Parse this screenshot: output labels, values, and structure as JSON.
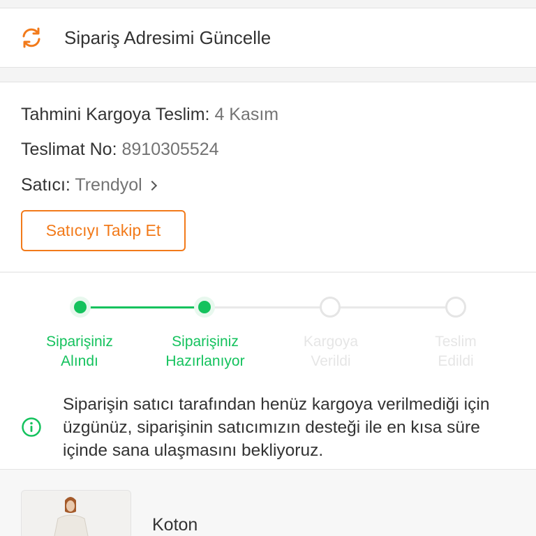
{
  "update_address": {
    "label": "Sipariş Adresimi Güncelle",
    "icon": "refresh-icon",
    "icon_color": "#f27a1a"
  },
  "delivery": {
    "estimate_key": "Tahmini Kargoya Teslim:",
    "estimate_value": "4 Kasım",
    "number_key": "Teslimat No:",
    "number_value": "8910305524",
    "seller_key": "Satıcı:",
    "seller_value": "Trendyol"
  },
  "follow_button": {
    "label": "Satıcıyı Takip Et",
    "color": "#f27a1a"
  },
  "tracker": {
    "active_color": "#14c25d",
    "steps": [
      {
        "label": "Siparişiniz\nAlındı",
        "status": "done"
      },
      {
        "label": "Siparişiniz\nHazırlanıyor",
        "status": "done"
      },
      {
        "label": "Kargoya\nVerildi",
        "status": "pending"
      },
      {
        "label": "Teslim\nEdildi",
        "status": "pending"
      }
    ]
  },
  "notice": {
    "icon": "info-icon",
    "text": "Siparişin satıcı tarafından henüz kargoya verilmediği için üzgünüz, siparişinin satıcımızın desteği ile en kısa süre içinde sana ulaşmasını bekliyoruz."
  },
  "product": {
    "brand": "Koton"
  }
}
